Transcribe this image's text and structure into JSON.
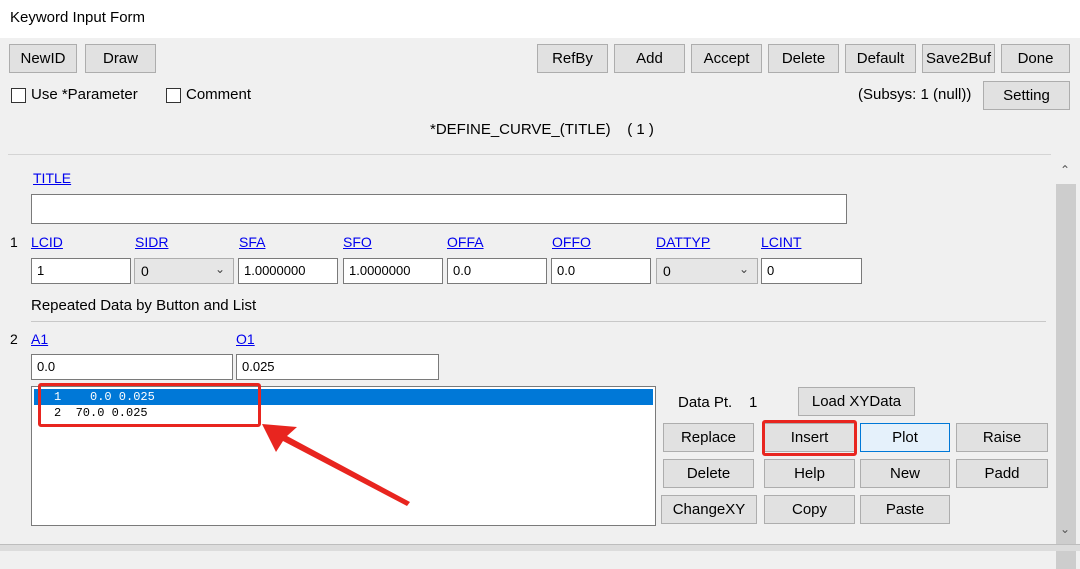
{
  "window": {
    "title": "Keyword Input Form"
  },
  "toolbar": {
    "left": [
      "NewID",
      "Draw"
    ],
    "right": [
      "RefBy",
      "Add",
      "Accept",
      "Delete",
      "Default",
      "Save2Buf",
      "Done"
    ]
  },
  "options": {
    "use_parameter": "Use *Parameter",
    "comment": "Comment",
    "subsys": "(Subsys: 1 (null))",
    "setting": "Setting"
  },
  "keyword": {
    "header": "*DEFINE_CURVE_(TITLE)    ( 1 )"
  },
  "card0": {
    "title_label": "TITLE",
    "title_value": ""
  },
  "card1": {
    "row_number": "1",
    "labels": [
      "LCID",
      "SIDR",
      "SFA",
      "SFO",
      "OFFA",
      "OFFO",
      "DATTYP",
      "LCINT"
    ],
    "values": [
      "1",
      "0",
      "1.0000000",
      "1.0000000",
      "0.0",
      "0.0",
      "0",
      "0"
    ]
  },
  "repeated": {
    "heading": "Repeated Data by Button and List"
  },
  "card2": {
    "row_number": "2",
    "labels": [
      "A1",
      "O1"
    ],
    "values": [
      "0.0",
      "0.025"
    ]
  },
  "list": {
    "rows": [
      "1    0.0 0.025",
      "2  70.0 0.025"
    ],
    "selected_index": 0
  },
  "controls": {
    "data_pt_label": "Data Pt.",
    "data_pt_value": "1",
    "load_xy": "Load XYData",
    "buttons": [
      [
        "Replace",
        "Insert",
        "Plot",
        "Raise"
      ],
      [
        "Delete",
        "Help",
        "New",
        "Padd"
      ],
      [
        "ChangeXY",
        "Copy",
        "Paste"
      ]
    ]
  },
  "annotation_color": "#e8251f",
  "icons": {
    "scroll_up": "chevron-up-icon",
    "scroll_down": "chevron-down-icon",
    "dropdown": "chevron-down-icon"
  }
}
